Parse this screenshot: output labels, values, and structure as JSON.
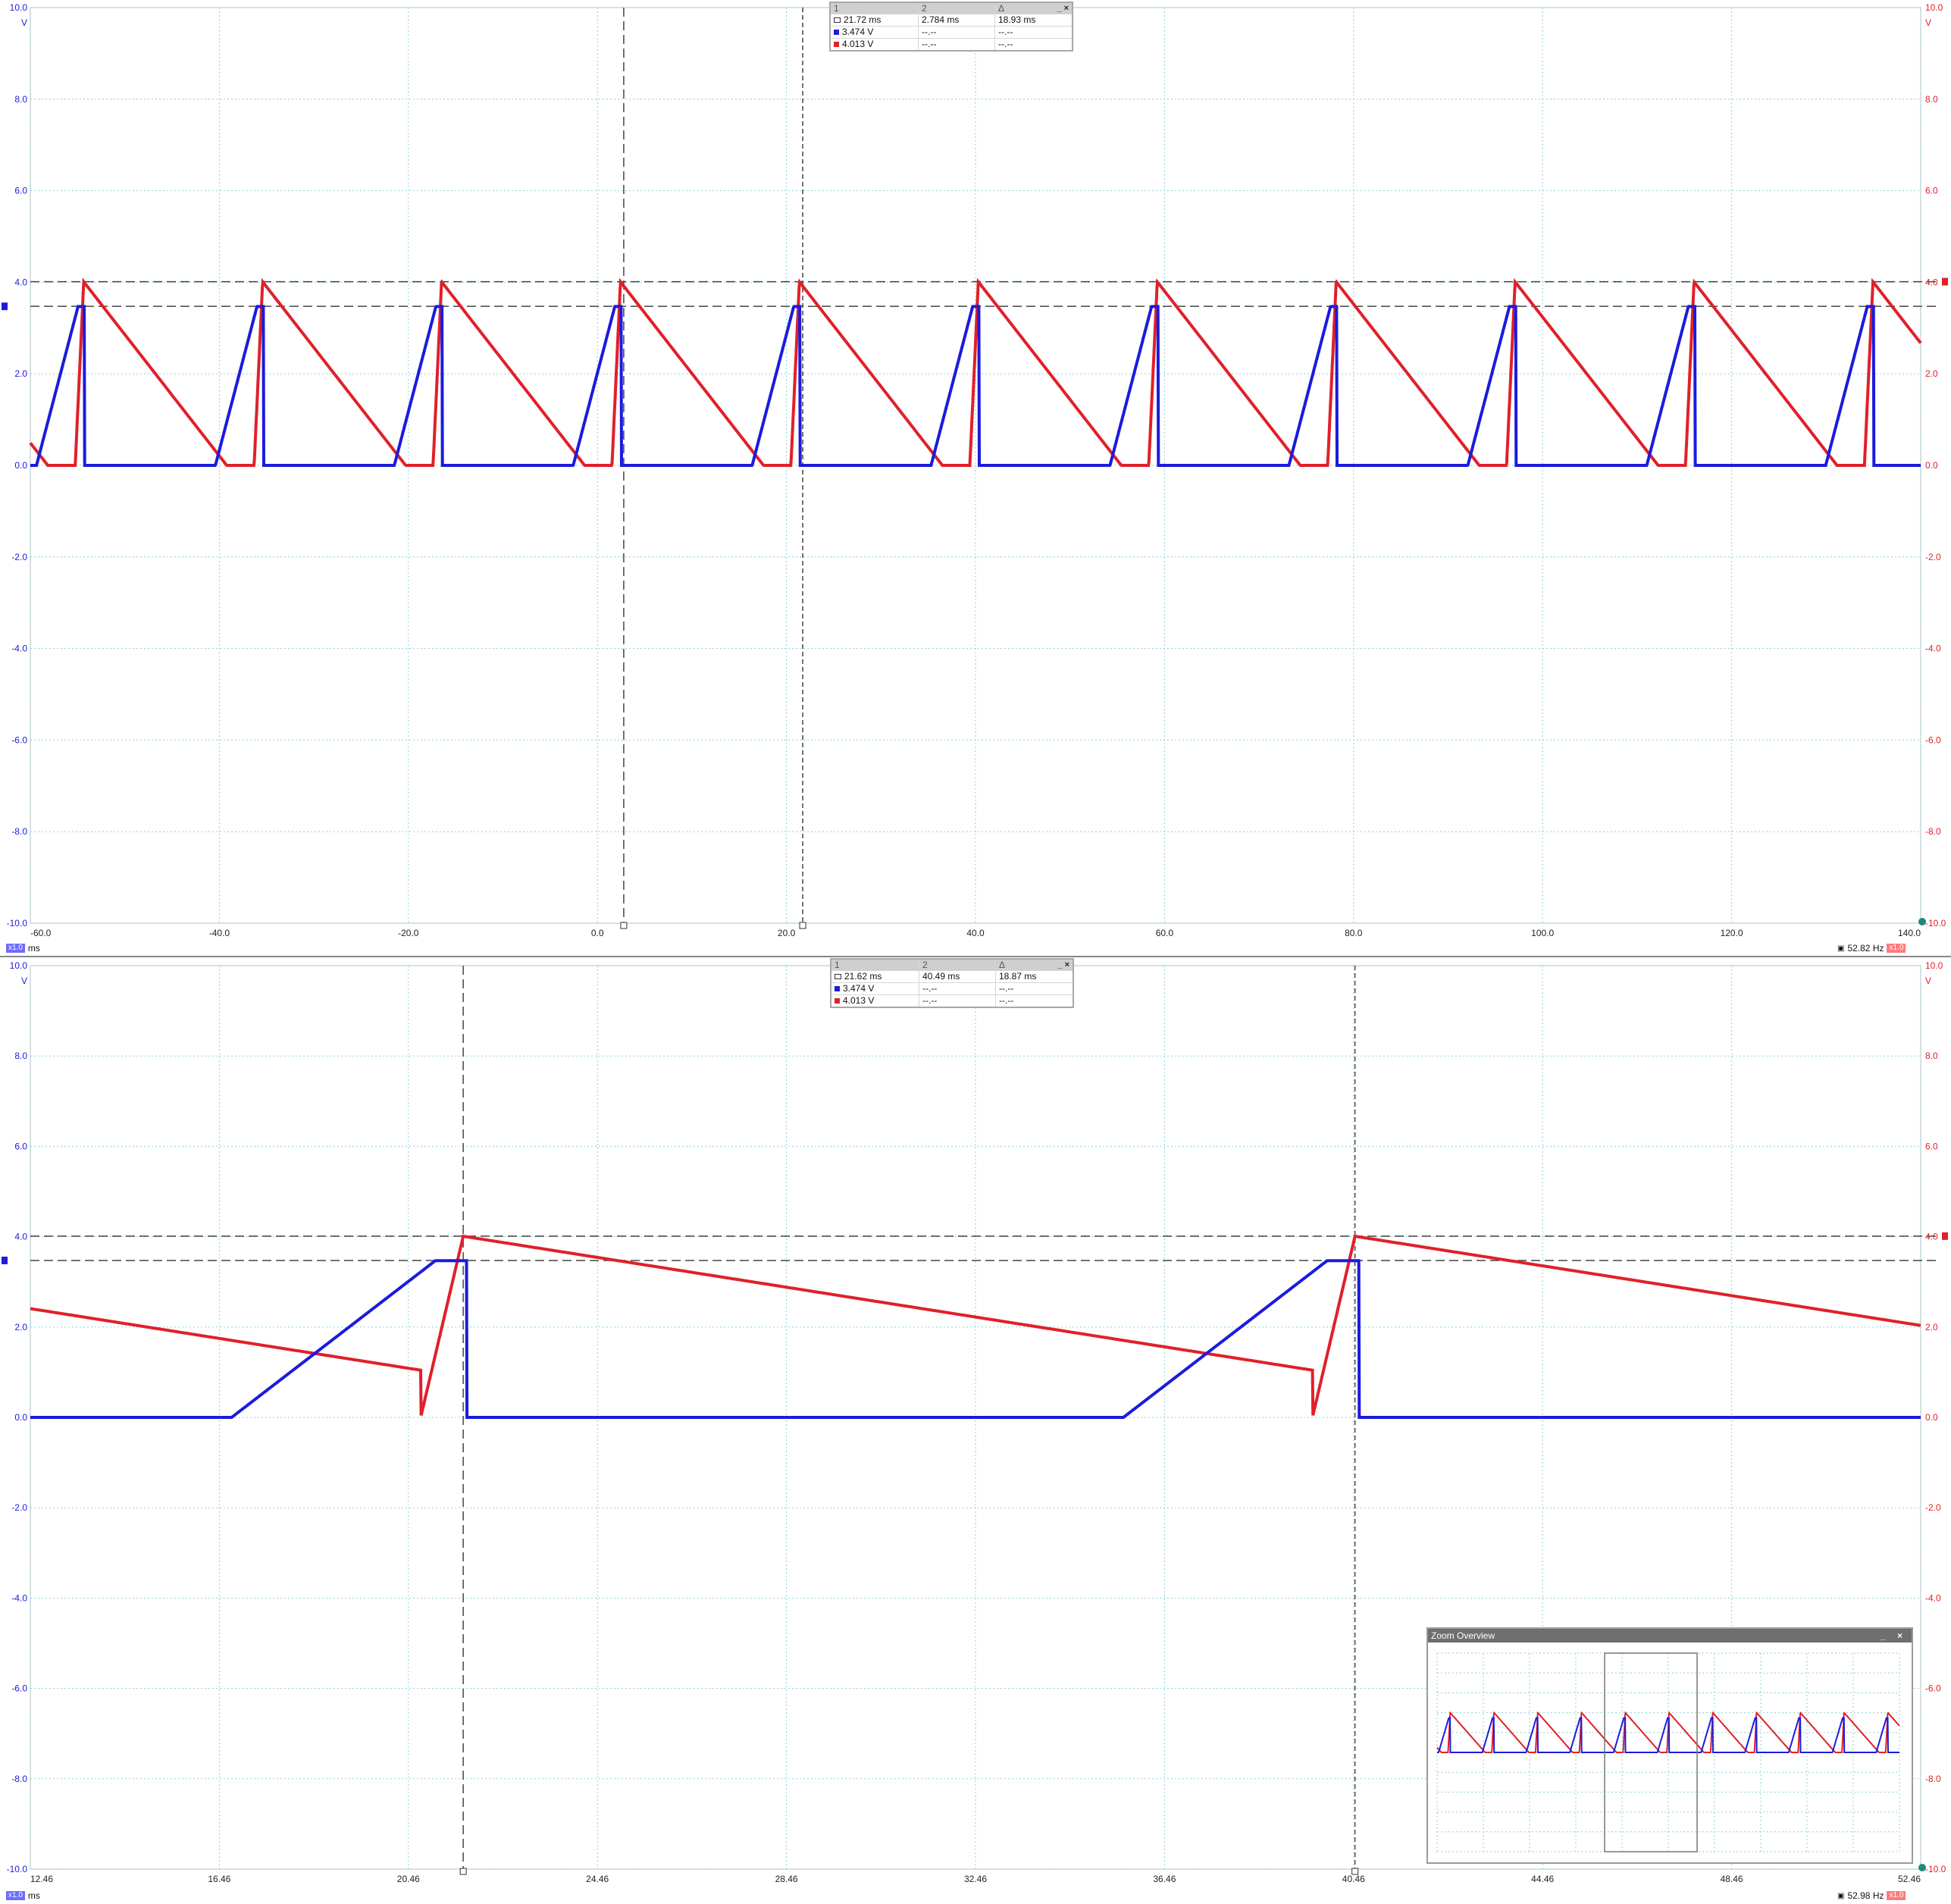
{
  "chart_data": [
    {
      "type": "line",
      "title": "",
      "xlabel": "ms",
      "ylabel": "V",
      "xlim": [
        -60,
        140
      ],
      "ylim": [
        -10,
        10
      ],
      "x_ticks": [
        "-60.0",
        "-40.0",
        "-20.0",
        "0.0",
        "20.0",
        "40.0",
        "60.0",
        "80.0",
        "100.0",
        "120.0",
        "140.0"
      ],
      "y_ticks": [
        "10.0",
        "8.0",
        "6.0",
        "4.0",
        "2.0",
        "0.0",
        "-2.0",
        "-4.0",
        "-6.0",
        "-8.0",
        "-10.0"
      ],
      "series": [
        {
          "color": "#1b1bdd",
          "style": "blue-ramp",
          "period": 18.93,
          "first_reset": -54.35,
          "ramp_ms": 5.0,
          "peak": 3.47,
          "low": 0.0,
          "values_note": ""
        },
        {
          "color": "#e0202a",
          "style": "red-decay",
          "period": 18.93,
          "first_reset": -54.35,
          "peak": 4.01,
          "decay_per_ms": 0.265,
          "low": 0.0
        }
      ],
      "cursors": {
        "x1": 2.784,
        "x2": 21.72,
        "y1": 3.474,
        "y2": 4.013
      },
      "grid": true
    },
    {
      "type": "line",
      "title": "",
      "xlabel": "ms",
      "ylabel": "V",
      "xlim": [
        12.46,
        52.46
      ],
      "ylim": [
        -10,
        10
      ],
      "x_ticks": [
        "12.46",
        "16.46",
        "20.46",
        "24.46",
        "28.46",
        "32.46",
        "36.46",
        "40.46",
        "44.46",
        "48.46",
        "52.46"
      ],
      "y_ticks": [
        "10.0",
        "8.0",
        "6.0",
        "4.0",
        "2.0",
        "0.0",
        "-2.0",
        "-4.0",
        "-6.0",
        "-8.0",
        "-10.0"
      ],
      "series": [
        {
          "color": "#1b1bdd",
          "style": "blue-ramp",
          "period": 18.87,
          "first_reset": 21.62,
          "ramp_ms": 4.9,
          "peak": 3.47,
          "low": 0.0
        },
        {
          "color": "#e0202a",
          "style": "red-decay",
          "period": 18.87,
          "first_reset": 21.62,
          "peak": 4.01,
          "decay_per_ms": 0.165,
          "low": 0.0
        }
      ],
      "cursors": {
        "x1": 21.62,
        "x2": 40.49,
        "y1": 3.474,
        "y2": 4.013
      },
      "grid": true
    }
  ],
  "panel1": {
    "y_unit": "V",
    "x_unit": "ms",
    "right_top": "10.0",
    "right_unit": "V",
    "freq": "52.82 Hz",
    "chip_left": "x1.0",
    "chip_right": "x1.0",
    "cursor_box": {
      "headers": [
        "1",
        "2",
        "Δ"
      ],
      "rows": [
        [
          "21.72 ms",
          "2.784 ms",
          "18.93 ms"
        ],
        [
          "3.474 V",
          "--.--",
          "--.--"
        ],
        [
          "4.013 V",
          "--.--",
          "--.--"
        ]
      ]
    }
  },
  "panel2": {
    "y_unit": "V",
    "x_unit": "ms",
    "right_top": "10.0",
    "right_unit": "V",
    "freq": "52.98 Hz",
    "chip_left": "x1.0",
    "chip_right": "x1.0",
    "cursor_box": {
      "headers": [
        "1",
        "2",
        "Δ"
      ],
      "rows": [
        [
          "21.62 ms",
          "40.49 ms",
          "18.87 ms"
        ],
        [
          "3.474 V",
          "--.--",
          "--.--"
        ],
        [
          "4.013 V",
          "--.--",
          "--.--"
        ]
      ]
    }
  },
  "zoom_overview": {
    "title": "Zoom Overview",
    "controls": "_ ×"
  },
  "colors": {
    "ch1": "#1b1bdd",
    "ch2": "#e0202a",
    "grid": "#8fd0d8",
    "cursor": "#444444"
  }
}
